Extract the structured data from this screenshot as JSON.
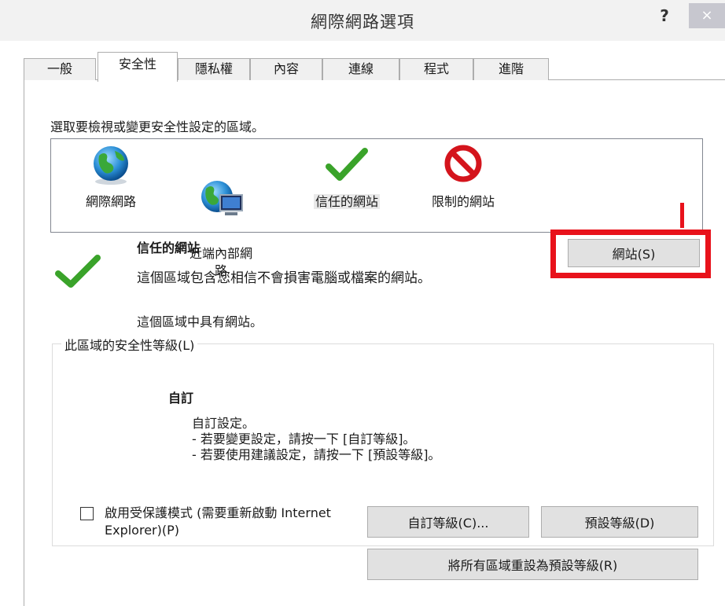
{
  "window": {
    "title": "網際網路選項",
    "help_label": "?",
    "close_label": "×"
  },
  "tabs": [
    {
      "label": "一般",
      "active": false
    },
    {
      "label": "安全性",
      "active": true
    },
    {
      "label": "隱私權",
      "active": false
    },
    {
      "label": "內容",
      "active": false
    },
    {
      "label": "連線",
      "active": false
    },
    {
      "label": "程式",
      "active": false
    },
    {
      "label": "進階",
      "active": false
    }
  ],
  "security": {
    "zone_prompt": "選取要檢視或變更安全性設定的區域。",
    "zones": [
      {
        "label": "網際網路",
        "icon": "globe-icon"
      },
      {
        "label": "近端內部網\n路",
        "icon": "intranet-icon"
      },
      {
        "label": "信任的網站",
        "icon": "checkmark-icon",
        "selected": true
      },
      {
        "label": "限制的網站",
        "icon": "restricted-icon"
      }
    ],
    "selected_zone": {
      "name": "信任的網站",
      "description": "這個區域包含您相信不會損害電腦或檔案的網站。",
      "note": "這個區域中具有網站。"
    },
    "sites_button_label": "網站(S)",
    "level_group_label": "此區域的安全性等級(L)",
    "level": {
      "name": "自訂",
      "description": "自訂設定。\n- 若要變更設定，請按一下 [自訂等級]。\n- 若要使用建議設定，請按一下 [預設等級]。"
    },
    "protected_mode": {
      "label": "啟用受保護模式 (需要重新啟動 Internet Explorer)(P)",
      "checked": false
    },
    "custom_level_button_label": "自訂等級(C)...",
    "default_level_button_label": "預設等級(D)",
    "reset_all_button_label": "將所有區域重設為預設等級(R)"
  },
  "colors": {
    "highlight": "#e8121b",
    "check_green": "#3aa32a",
    "stop_red": "#d4141c"
  }
}
